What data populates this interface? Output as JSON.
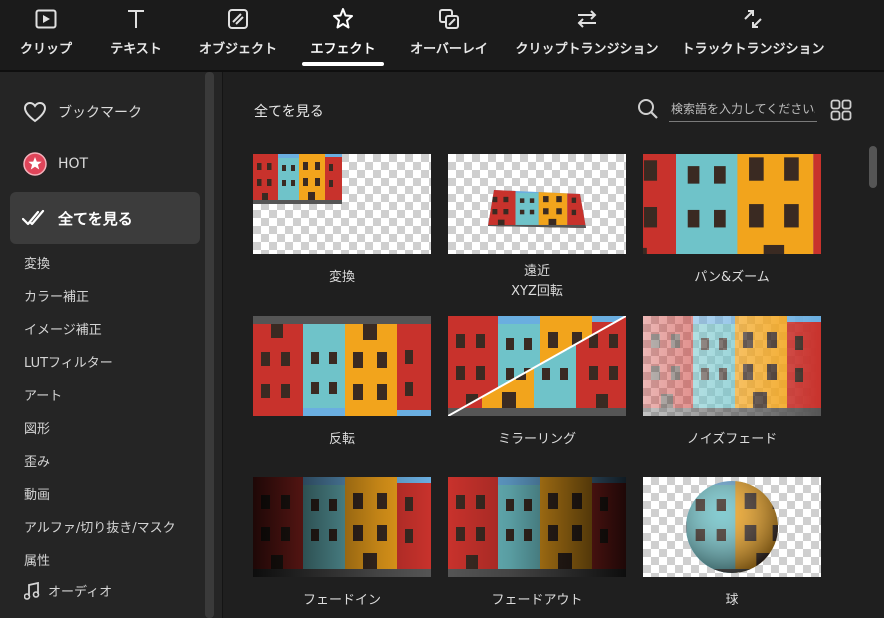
{
  "tabs": [
    {
      "label": "クリップ",
      "icon": "clip-icon"
    },
    {
      "label": "テキスト",
      "icon": "text-icon"
    },
    {
      "label": "オブジェクト",
      "icon": "object-icon"
    },
    {
      "label": "エフェクト",
      "icon": "effect-icon",
      "active": true
    },
    {
      "label": "オーバーレイ",
      "icon": "overlay-icon"
    },
    {
      "label": "クリップトランジション",
      "icon": "clip-transition-icon"
    },
    {
      "label": "トラックトランジション",
      "icon": "track-transition-icon"
    }
  ],
  "sidebar": {
    "bookmark": "ブックマーク",
    "hot": "HOT",
    "all": "全てを見る",
    "categories": [
      "変換",
      "カラー補正",
      "イメージ補正",
      "LUTフィルター",
      "アート",
      "図形",
      "歪み",
      "動画",
      "アルファ/切り抜き/マスク",
      "属性"
    ],
    "audio": "オーディオ"
  },
  "main": {
    "title": "全てを見る",
    "search_placeholder": "検索語を入力してください。"
  },
  "effects": [
    {
      "label": "変換"
    },
    {
      "label": "遠近",
      "label2": "XYZ回転"
    },
    {
      "label": "パン&ズーム"
    },
    {
      "label": "反転"
    },
    {
      "label": "ミラーリング"
    },
    {
      "label": "ノイズフェード"
    },
    {
      "label": "フェードイン"
    },
    {
      "label": "フェードアウト"
    },
    {
      "label": "球"
    }
  ],
  "colors": {
    "accent": "#ffffff",
    "hot_badge": "#e0455a",
    "house_red": "#c8322c",
    "house_yellow": "#f2a41c",
    "house_teal": "#6fc3c9",
    "sky": "#6aaee0"
  }
}
